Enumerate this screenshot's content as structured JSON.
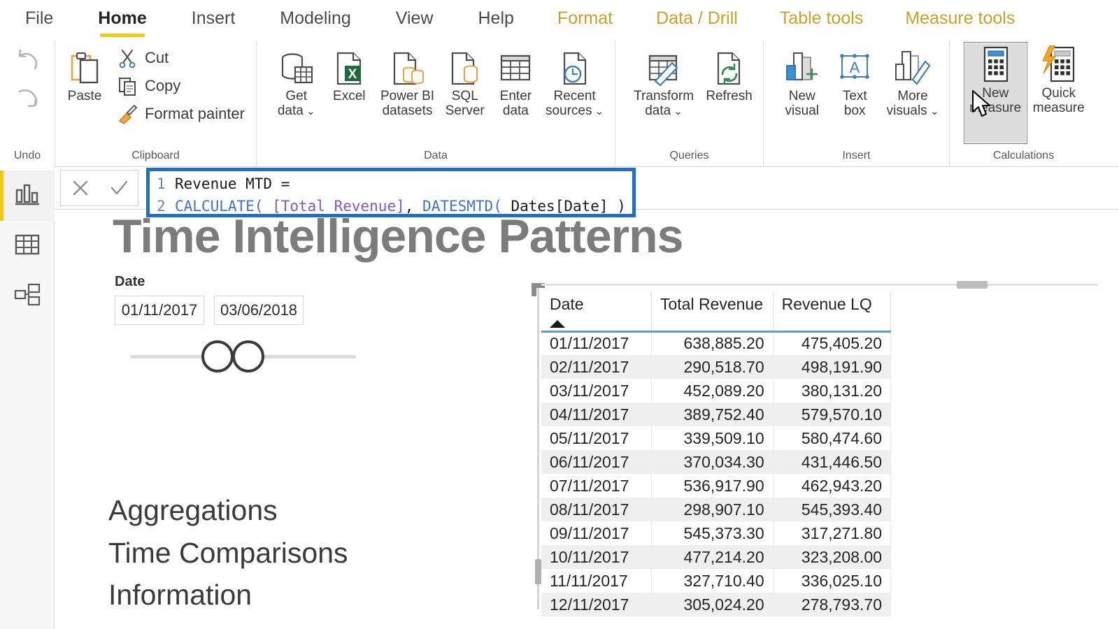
{
  "ribbon": {
    "tabs": [
      {
        "label": "File",
        "state": "normal"
      },
      {
        "label": "Home",
        "state": "active"
      },
      {
        "label": "Insert",
        "state": "normal"
      },
      {
        "label": "Modeling",
        "state": "normal"
      },
      {
        "label": "View",
        "state": "normal"
      },
      {
        "label": "Help",
        "state": "normal"
      },
      {
        "label": "Format",
        "state": "contextual"
      },
      {
        "label": "Data / Drill",
        "state": "contextual"
      },
      {
        "label": "Table tools",
        "state": "contextual"
      },
      {
        "label": "Measure tools",
        "state": "contextual"
      }
    ],
    "groups": {
      "undo": {
        "label": "Undo",
        "undo_icon": "undo-arrow-icon",
        "redo_icon": "redo-arrow-icon"
      },
      "clipboard": {
        "label": "Clipboard",
        "paste_label": "Paste",
        "cut_label": "Cut",
        "copy_label": "Copy",
        "format_painter_label": "Format painter"
      },
      "data": {
        "label": "Data",
        "items": [
          {
            "line1": "Get",
            "line2": "data",
            "caret": true,
            "icon": "get-data-icon"
          },
          {
            "line1": "Excel",
            "line2": "",
            "caret": false,
            "icon": "excel-icon"
          },
          {
            "line1": "Power BI",
            "line2": "datasets",
            "caret": false,
            "icon": "powerbi-datasets-icon"
          },
          {
            "line1": "SQL",
            "line2": "Server",
            "caret": false,
            "icon": "sql-server-icon"
          },
          {
            "line1": "Enter",
            "line2": "data",
            "caret": false,
            "icon": "enter-data-icon"
          },
          {
            "line1": "Recent",
            "line2": "sources",
            "caret": true,
            "icon": "recent-sources-icon"
          }
        ]
      },
      "queries": {
        "label": "Queries",
        "items": [
          {
            "line1": "Transform",
            "line2": "data",
            "caret": true,
            "icon": "transform-data-icon"
          },
          {
            "line1": "Refresh",
            "line2": "",
            "caret": false,
            "icon": "refresh-icon"
          }
        ]
      },
      "insert": {
        "label": "Insert",
        "items": [
          {
            "line1": "New",
            "line2": "visual",
            "caret": false,
            "icon": "new-visual-icon"
          },
          {
            "line1": "Text",
            "line2": "box",
            "caret": false,
            "icon": "text-box-icon"
          },
          {
            "line1": "More",
            "line2": "visuals",
            "caret": true,
            "icon": "more-visuals-icon"
          }
        ]
      },
      "calculations": {
        "label": "Calculations",
        "items": [
          {
            "line1": "New",
            "line2": "measure",
            "caret": false,
            "icon": "new-measure-icon",
            "pressed": true
          },
          {
            "line1": "Quick",
            "line2": "measure",
            "caret": false,
            "icon": "quick-measure-icon",
            "pressed": false
          }
        ]
      }
    }
  },
  "formula_bar": {
    "cancel_icon": "cancel-x-icon",
    "commit_icon": "commit-check-icon",
    "lines": [
      {
        "number": "1",
        "tokens": [
          {
            "text": "Revenue MTD =",
            "kind": "plain"
          }
        ]
      },
      {
        "number": "2",
        "tokens": [
          {
            "text": "CALCULATE(",
            "kind": "fn"
          },
          {
            "text": " ",
            "kind": "plain"
          },
          {
            "text": "[Total Revenue]",
            "kind": "measure"
          },
          {
            "text": ", ",
            "kind": "plain"
          },
          {
            "text": "DATESMTD(",
            "kind": "fn"
          },
          {
            "text": " Dates[Date] ) )",
            "kind": "plain"
          }
        ]
      }
    ],
    "full_text": "Revenue MTD = CALCULATE( [Total Revenue], DATESMTD( Dates[Date] ) )",
    "border_color": "#1f6fc4"
  },
  "nav_rail": {
    "items": [
      {
        "name": "report-view",
        "icon": "report-bar-chart-icon",
        "active": true
      },
      {
        "name": "data-view",
        "icon": "data-table-icon",
        "active": false
      },
      {
        "name": "model-view",
        "icon": "model-relationships-icon",
        "active": false
      }
    ]
  },
  "canvas": {
    "report_title": "Time Intelligence Patterns",
    "slicer": {
      "label": "Date",
      "start_value": "01/11/2017",
      "end_value": "03/06/2018"
    },
    "nav_text_items": [
      "Aggregations",
      "Time Comparisons",
      "Information"
    ]
  },
  "table_visual": {
    "columns": [
      "Date",
      "Total Revenue",
      "Revenue LQ"
    ],
    "sort_column": "Date",
    "sort_direction": "ascending",
    "rows": [
      [
        "01/11/2017",
        "638,885.20",
        "475,405.20"
      ],
      [
        "02/11/2017",
        "290,518.70",
        "498,191.90"
      ],
      [
        "03/11/2017",
        "452,089.20",
        "380,131.20"
      ],
      [
        "04/11/2017",
        "389,752.40",
        "579,570.10"
      ],
      [
        "05/11/2017",
        "339,509.10",
        "580,474.60"
      ],
      [
        "06/11/2017",
        "370,034.30",
        "431,446.50"
      ],
      [
        "07/11/2017",
        "536,917.90",
        "462,943.20"
      ],
      [
        "08/11/2017",
        "298,907.10",
        "545,393.40"
      ],
      [
        "09/11/2017",
        "545,373.30",
        "317,271.80"
      ],
      [
        "10/11/2017",
        "477,214.20",
        "323,208.00"
      ],
      [
        "11/11/2017",
        "327,710.40",
        "336,025.10"
      ],
      [
        "12/11/2017",
        "305,024.20",
        "278,793.70"
      ]
    ]
  },
  "colors": {
    "accent_yellow": "#f2c811",
    "contextual_tab": "#c9a227",
    "formula_border": "#1f6fc4",
    "header_underline": "#5b9bd5",
    "dax_function": "#4272c8",
    "dax_measure": "#8a56b5",
    "alt_row": "#efefef"
  },
  "cursor": {
    "icon": "mouse-pointer-icon"
  }
}
